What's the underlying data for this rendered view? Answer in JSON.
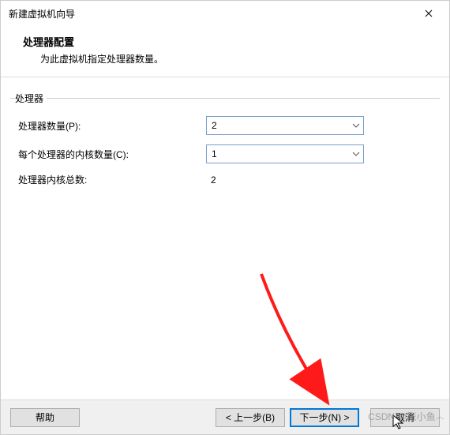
{
  "window": {
    "title": "新建虚拟机向导",
    "close_icon": "✕"
  },
  "header": {
    "title": "处理器配置",
    "subtitle": "为此虚拟机指定处理器数量。"
  },
  "group": {
    "legend": "处理器",
    "rows": {
      "processors": {
        "label": "处理器数量(P):",
        "value": "2"
      },
      "cores": {
        "label": "每个处理器的内核数量(C):",
        "value": "1"
      },
      "total": {
        "label": "处理器内核总数:",
        "value": "2"
      }
    }
  },
  "footer": {
    "help": "帮助",
    "back": "< 上一步(B)",
    "next": "下一步(N) >",
    "cancel": "取消"
  },
  "watermark": "CSDN @张小鱼෴"
}
